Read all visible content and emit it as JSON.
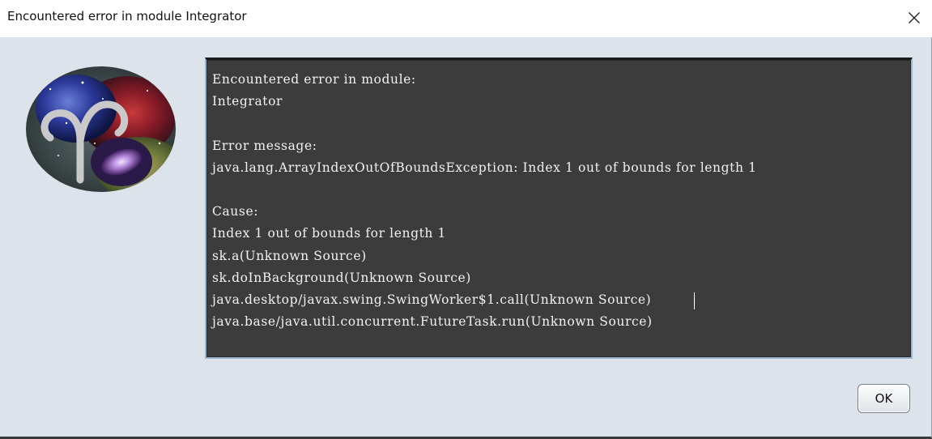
{
  "window": {
    "title": "Encountered error in module Integrator"
  },
  "icons": {
    "close": "close-icon",
    "logo": "aries-galaxy-logo"
  },
  "console": {
    "lines": [
      "Encountered error in module:",
      "Integrator",
      "",
      "Error message:",
      "java.lang.ArrayIndexOutOfBoundsException: Index 1 out of bounds for length 1",
      "",
      "Cause:",
      "Index 1 out of bounds for length 1",
      "sk.a(Unknown Source)",
      "sk.doInBackground(Unknown Source)",
      "java.desktop/javax.swing.SwingWorker$1.call(Unknown Source)",
      "java.base/java.util.concurrent.FutureTask.run(Unknown Source)"
    ]
  },
  "buttons": {
    "ok_label": "OK"
  },
  "colors": {
    "window_bg": "#dde3ea",
    "console_bg": "#3c3c3c",
    "console_text": "#f2f2f2",
    "console_border": "#9ab3d0"
  }
}
